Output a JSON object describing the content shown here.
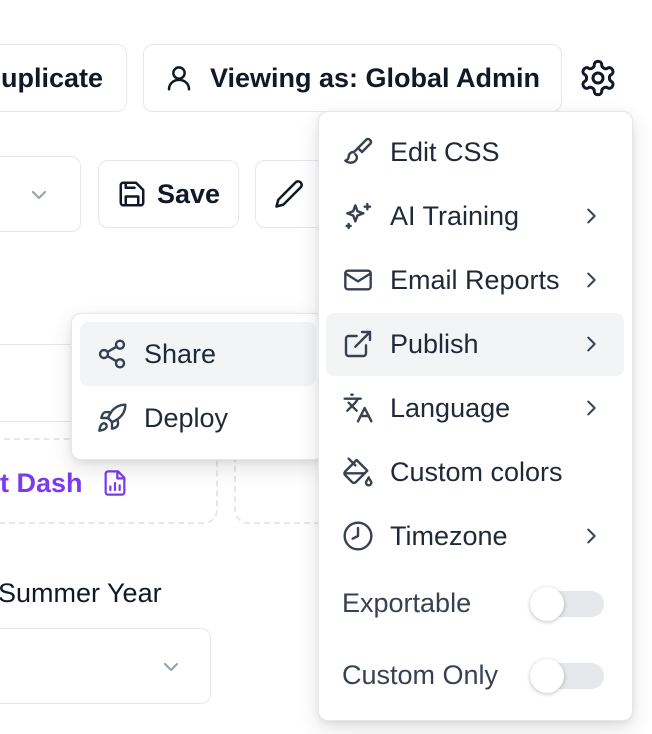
{
  "toolbar": {
    "duplicate_label": "uplicate",
    "viewing_as_label": "Viewing as: Global Admin",
    "save_label": "Save"
  },
  "content": {
    "dash_link_label": "t Dash",
    "field_label": "Summer Year"
  },
  "settings_menu": {
    "items": [
      {
        "label": "Edit CSS",
        "icon": "paintbrush-icon",
        "submenu": false
      },
      {
        "label": "AI Training",
        "icon": "sparkles-icon",
        "submenu": true
      },
      {
        "label": "Email Reports",
        "icon": "mail-icon",
        "submenu": true
      },
      {
        "label": "Publish",
        "icon": "external-link-icon",
        "submenu": true,
        "highlighted": true
      },
      {
        "label": "Language",
        "icon": "languages-icon",
        "submenu": true
      },
      {
        "label": "Custom colors",
        "icon": "paint-bucket-icon",
        "submenu": false
      },
      {
        "label": "Timezone",
        "icon": "clock-icon",
        "submenu": true
      }
    ],
    "toggles": [
      {
        "label": "Exportable",
        "on": false
      },
      {
        "label": "Custom Only",
        "on": false
      }
    ]
  },
  "publish_submenu": {
    "items": [
      {
        "label": "Share",
        "icon": "share-icon",
        "highlighted": true
      },
      {
        "label": "Deploy",
        "icon": "rocket-icon"
      }
    ]
  },
  "colors": {
    "accent": "#7c3aed",
    "highlight": "#f3f4f6",
    "border": "#e5e7eb"
  }
}
